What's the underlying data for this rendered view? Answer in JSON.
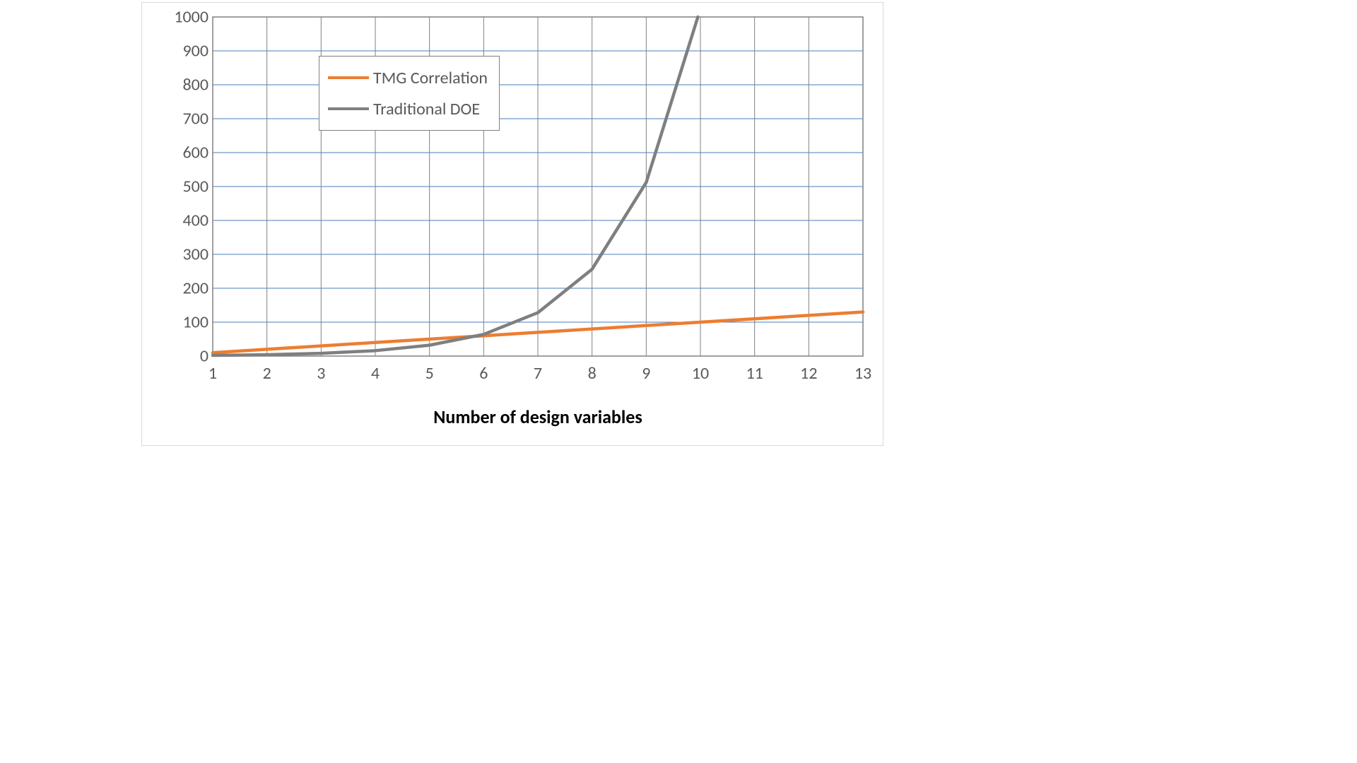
{
  "chart_data": {
    "type": "line",
    "xlabel": "Number of design variables",
    "ylabel": "",
    "xlim": [
      1,
      13
    ],
    "ylim": [
      0,
      1000
    ],
    "x_ticks": [
      1,
      2,
      3,
      4,
      5,
      6,
      7,
      8,
      9,
      10,
      11,
      12,
      13
    ],
    "y_ticks": [
      0,
      100,
      200,
      300,
      400,
      500,
      600,
      700,
      800,
      900,
      1000
    ],
    "grid": true,
    "legend_position": "upper-left-inside",
    "series": [
      {
        "name": "TMG Correlation",
        "color": "#ED7D31",
        "x": [
          1,
          2,
          3,
          4,
          5,
          6,
          7,
          8,
          9,
          10,
          11,
          12,
          13
        ],
        "values": [
          10,
          20,
          30,
          40,
          50,
          60,
          70,
          80,
          90,
          100,
          110,
          120,
          130
        ]
      },
      {
        "name": "Traditional DOE",
        "color": "#7F7F7F",
        "x": [
          1,
          2,
          3,
          4,
          5,
          6,
          7,
          8,
          9,
          10
        ],
        "values": [
          2,
          4,
          8,
          16,
          32,
          64,
          128,
          256,
          512,
          1024
        ]
      }
    ]
  },
  "axis": {
    "x_title": "Number of design variables"
  },
  "legend": {
    "items": [
      {
        "label": "TMG Correlation",
        "color": "#ED7D31"
      },
      {
        "label": "Traditional DOE",
        "color": "#7F7F7F"
      }
    ]
  },
  "y_tick_labels": [
    "0",
    "100",
    "200",
    "300",
    "400",
    "500",
    "600",
    "700",
    "800",
    "900",
    "1000"
  ],
  "x_tick_labels": [
    "1",
    "2",
    "3",
    "4",
    "5",
    "6",
    "7",
    "8",
    "9",
    "10",
    "11",
    "12",
    "13"
  ]
}
